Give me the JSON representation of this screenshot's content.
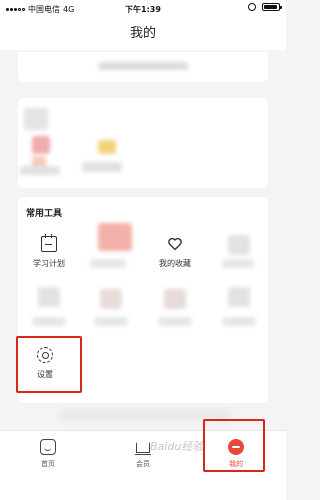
{
  "status_bar": {
    "carrier": "中国电信",
    "network": "4G",
    "time": "下午1:39"
  },
  "header": {
    "title": "我的"
  },
  "tools": {
    "section_title": "常用工具",
    "items": [
      {
        "label": "学习计划",
        "icon": "calendar-icon"
      },
      {
        "label": "我的收藏",
        "icon": "heart-icon"
      },
      {
        "label": "设置",
        "icon": "gear-icon"
      }
    ]
  },
  "tabbar": {
    "items": [
      {
        "label": "首页",
        "icon": "home-icon"
      },
      {
        "label": "会员",
        "icon": "crown-icon"
      },
      {
        "label": "我的",
        "icon": "profile-icon",
        "active": true
      }
    ]
  },
  "watermark": "Baidu经验",
  "colors": {
    "accent": "#e8473a",
    "highlight_box": "#d7261b"
  }
}
